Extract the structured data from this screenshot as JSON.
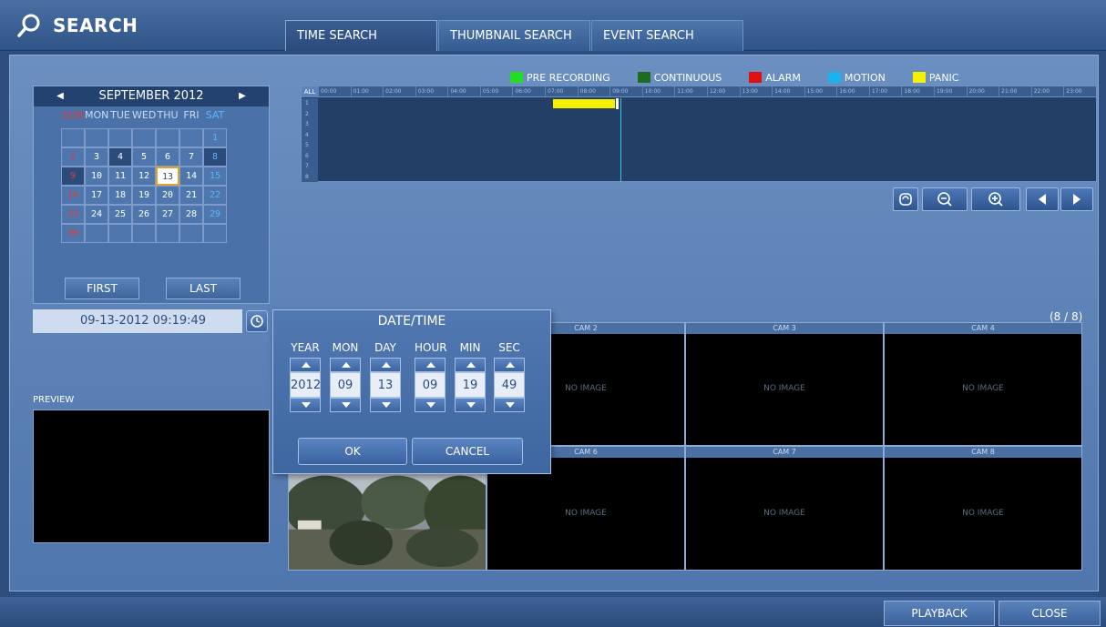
{
  "header": {
    "title": "SEARCH",
    "icon": "search-icon",
    "tabs": [
      {
        "label": "TIME SEARCH",
        "active": true
      },
      {
        "label": "THUMBNAIL SEARCH",
        "active": false
      },
      {
        "label": "EVENT SEARCH",
        "active": false
      }
    ]
  },
  "calendar": {
    "month_label": "SEPTEMBER 2012",
    "weekdays": [
      "SUN",
      "MON",
      "TUE",
      "WED",
      "THU",
      "FRI",
      "SAT"
    ],
    "weeks": [
      [
        "",
        "",
        "",
        "",
        "",
        "",
        "1"
      ],
      [
        "2",
        "3",
        "4",
        "5",
        "6",
        "7",
        "8"
      ],
      [
        "9",
        "10",
        "11",
        "12",
        "13",
        "14",
        "15"
      ],
      [
        "16",
        "17",
        "18",
        "19",
        "20",
        "21",
        "22"
      ],
      [
        "23",
        "24",
        "25",
        "26",
        "27",
        "28",
        "29"
      ],
      [
        "30",
        "",
        "",
        "",
        "",
        "",
        ""
      ]
    ],
    "selected_day": "13",
    "recorded_days": [
      "4",
      "8",
      "9"
    ],
    "first_label": "FIRST",
    "last_label": "LAST"
  },
  "datetime_display": "09-13-2012  09:19:49",
  "preview_label": "PREVIEW",
  "legend": [
    {
      "label": "PRE RECORDING",
      "color": "#22dd22"
    },
    {
      "label": "CONTINUOUS",
      "color": "#1f6b1f"
    },
    {
      "label": "ALARM",
      "color": "#e01010"
    },
    {
      "label": "MOTION",
      "color": "#1ab3f0"
    },
    {
      "label": "PANIC",
      "color": "#f4f000"
    }
  ],
  "timeline": {
    "all_label": "ALL",
    "hours": [
      "00:00",
      "01:00",
      "02:00",
      "03:00",
      "04:00",
      "05:00",
      "06:00",
      "07:00",
      "08:00",
      "09:00",
      "10:00",
      "11:00",
      "12:00",
      "13:00",
      "14:00",
      "15:00",
      "16:00",
      "17:00",
      "18:00",
      "19:00",
      "20:00",
      "21:00",
      "22:00",
      "23:00"
    ],
    "channels": [
      "1",
      "2",
      "3",
      "4",
      "5",
      "6",
      "7",
      "8"
    ]
  },
  "page_count": "(8 / 8)",
  "cameras": [
    {
      "label": "CAM 2",
      "text": "NO IMAGE"
    },
    {
      "label": "CAM 3",
      "text": "NO IMAGE"
    },
    {
      "label": "CAM 4",
      "text": "NO IMAGE"
    },
    {
      "label": "CAM 6",
      "text": "NO IMAGE"
    },
    {
      "label": "CAM 7",
      "text": "NO IMAGE"
    },
    {
      "label": "CAM 8",
      "text": "NO IMAGE"
    }
  ],
  "dialog": {
    "title": "DATE/TIME",
    "fields": [
      {
        "label": "YEAR",
        "value": "2012"
      },
      {
        "label": "MON",
        "value": "09"
      },
      {
        "label": "DAY",
        "value": "13"
      },
      {
        "label": "HOUR",
        "value": "09"
      },
      {
        "label": "MIN",
        "value": "19"
      },
      {
        "label": "SEC",
        "value": "49"
      }
    ],
    "ok_label": "OK",
    "cancel_label": "CANCEL"
  },
  "footer": {
    "playback_label": "PLAYBACK",
    "close_label": "CLOSE"
  }
}
